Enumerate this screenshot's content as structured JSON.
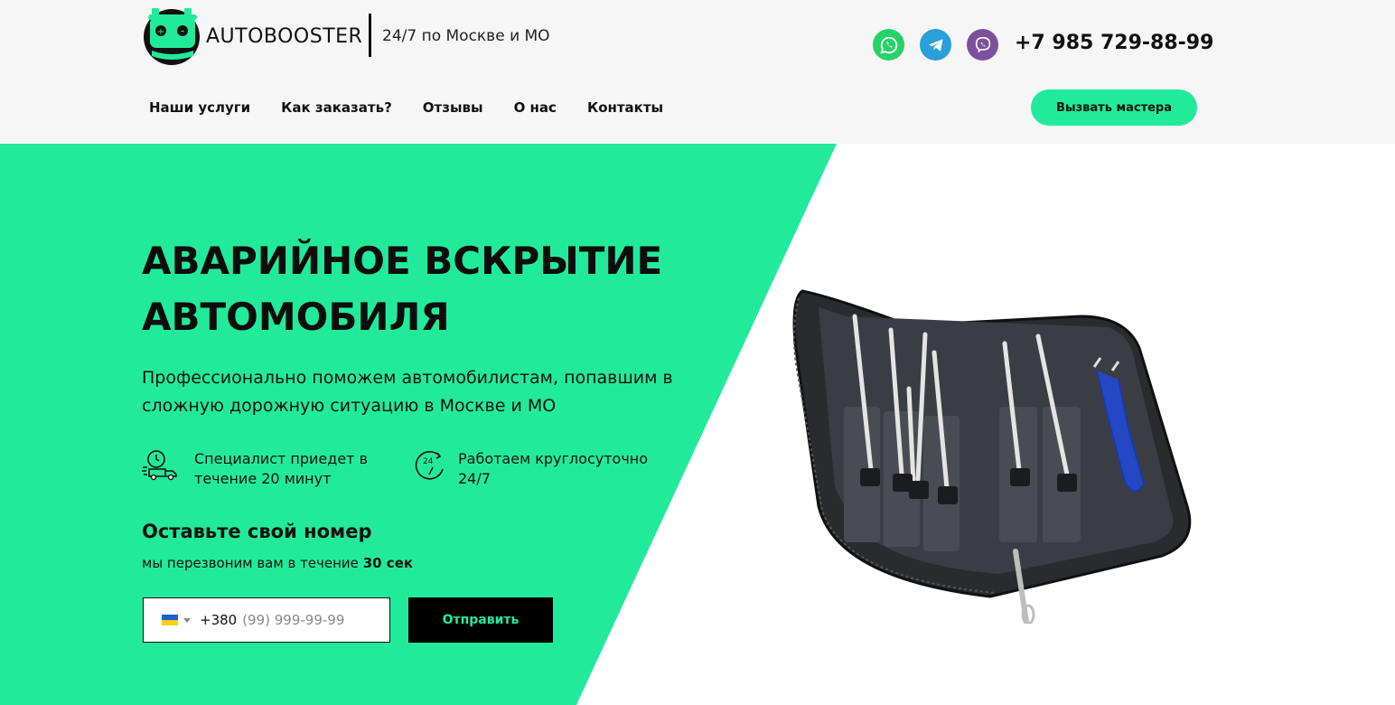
{
  "header": {
    "logo_text": "AUTOBOOSTER",
    "tagline": "24/7 по Москве и МО",
    "phone": "+7 985 729-88-99",
    "messengers": [
      {
        "name": "whatsapp-icon",
        "color": "#25d366"
      },
      {
        "name": "telegram-icon",
        "color": "#2a9fd9"
      },
      {
        "name": "viber-icon",
        "color": "#7b519d"
      }
    ],
    "nav": [
      "Наши услуги",
      "Как заказать?",
      "Отзывы",
      "О нас",
      "Контакты"
    ],
    "cta_label": "Вызвать мастера"
  },
  "hero": {
    "title_line1": "АВАРИЙНОЕ ВСКРЫТИЕ",
    "title_line2": "АВТОМОБИЛЯ",
    "subtitle_line1": "Профессионально поможем автомобилистам, попавшим в",
    "subtitle_line2": "сложную дорожную ситуацию в Москве и МО",
    "features": [
      {
        "line1": "Специалист приедет в",
        "line2": "течение 20 минут",
        "icon": "delivery-truck-clock-icon"
      },
      {
        "line1": "Работаем круглосуточно",
        "line2": "24/7",
        "icon": "24-hours-icon"
      }
    ]
  },
  "form": {
    "title": "Оставьте свой номер",
    "subtitle_prefix": "мы перезвоним вам в течение",
    "subtitle_bold": "30 сек",
    "country_code": "+380",
    "placeholder": "(99) 999-99-99",
    "submit_label": "Отправить"
  },
  "colors": {
    "accent": "#21eb9a",
    "header_bg": "#f6f6f6",
    "button_dark": "#000000"
  }
}
